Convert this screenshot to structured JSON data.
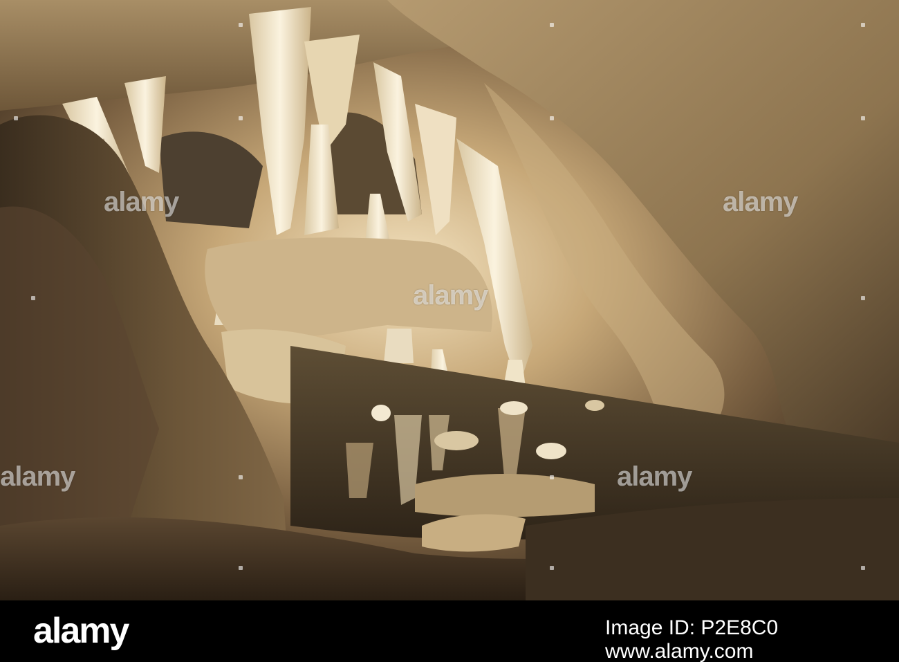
{
  "photo": {
    "subject": "cave-interior",
    "colors": {
      "rock_dark": "#3a2c1d",
      "rock_mid": "#7a6546",
      "rock_light": "#b79a6c",
      "formation": "#efe3c8",
      "water": "#4a3d2a"
    }
  },
  "watermark": {
    "text": "alamy"
  },
  "footer": {
    "logo": "alamy",
    "image_id": "Image ID: P2E8C0",
    "url": "www.alamy.com",
    "background": "#000000",
    "text_color": "#ffffff"
  }
}
